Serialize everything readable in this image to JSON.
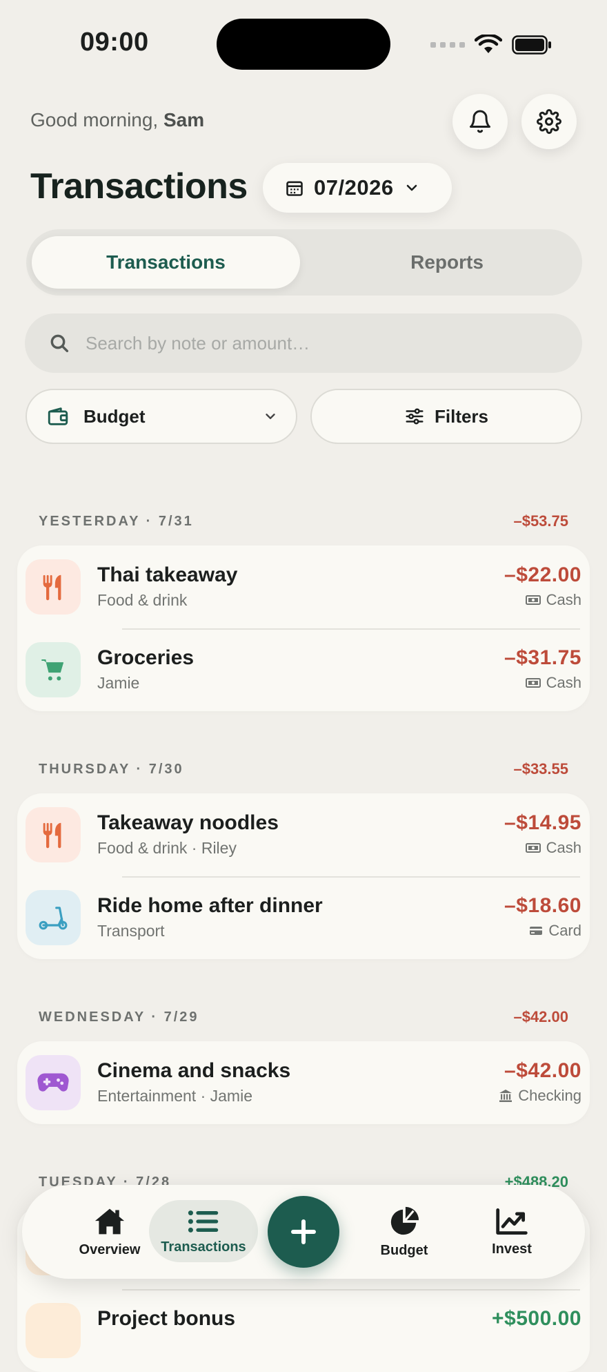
{
  "status_bar": {
    "time": "09:00"
  },
  "header": {
    "greeting_prefix": "Good morning, ",
    "user_name": "Sam",
    "title": "Transactions",
    "month": "07/2026"
  },
  "segment": {
    "active": "Transactions",
    "inactive": "Reports"
  },
  "search": {
    "placeholder": "Search by note or amount…"
  },
  "filters": {
    "budget_label": "Budget",
    "filters_label": "Filters"
  },
  "days": [
    {
      "label": "YESTERDAY · 7/31",
      "total": "–$53.75",
      "items": [
        {
          "title": "Thai takeaway",
          "sub": "Food & drink",
          "amount": "–$22.00",
          "account": "Cash"
        },
        {
          "title": "Groceries",
          "sub": "Jamie",
          "amount": "–$31.75",
          "account": "Cash"
        }
      ]
    },
    {
      "label": "THURSDAY · 7/30",
      "total": "–$33.55",
      "items": [
        {
          "title": "Takeaway noodles",
          "sub": "Food & drink · Riley",
          "amount": "–$14.95",
          "account": "Cash"
        },
        {
          "title": "Ride home after dinner",
          "sub": "Transport",
          "amount": "–$18.60",
          "account": "Card"
        }
      ]
    },
    {
      "label": "WEDNESDAY · 7/29",
      "total": "–$42.00",
      "items": [
        {
          "title": "Cinema and snacks",
          "sub": "Entertainment · Jamie",
          "amount": "–$42.00",
          "account": "Checking"
        }
      ]
    },
    {
      "label": "TUESDAY · 7/28",
      "total": "+$488.20",
      "items": [
        {
          "title": "Project bonus",
          "amount": "+$500.00"
        }
      ]
    }
  ],
  "nav": {
    "overview": "Overview",
    "transactions": "Transactions",
    "budget": "Budget",
    "invest": "Invest"
  },
  "icons": {
    "bell": "bell-icon",
    "gear": "gear-icon",
    "calendar": "calendar-icon",
    "search": "search-icon",
    "wallet": "wallet-icon",
    "sliders": "sliders-icon",
    "food": "fork-knife-icon",
    "cart": "cart-icon",
    "scooter": "scooter-icon",
    "gamepad": "gamepad-icon",
    "cash": "cash-icon",
    "card": "card-icon",
    "bank": "bank-icon",
    "home": "home-icon",
    "list": "list-icon",
    "plus": "plus-icon",
    "pie": "pie-chart-icon",
    "trend": "trend-icon"
  },
  "colors": {
    "accent": "#1d5c4f",
    "expense": "#bd4b3a",
    "income": "#2f8f5d",
    "background": "#f1efea",
    "surface": "#faf9f4"
  }
}
